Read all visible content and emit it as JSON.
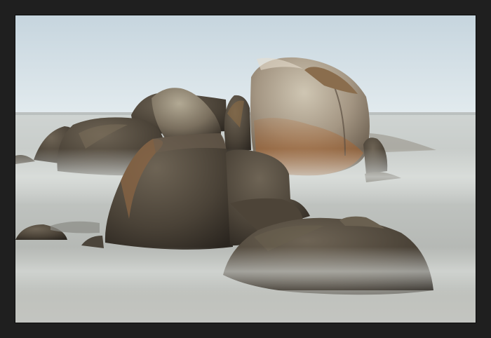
{
  "scene": {
    "type": "long-exposure seascape photograph",
    "colors": {
      "frame": "#1f1f1f",
      "sky_top": "#c9d7df",
      "sky_horizon": "#e6eef2",
      "sea_far": "#c8cfcf",
      "sea_mist": "#d6dbd9",
      "sea_near": "#a9adaa",
      "rock_dark": "#3a342c",
      "rock_mid": "#6d6454",
      "rock_light": "#b7ac97",
      "rust": "#a0622f"
    }
  }
}
